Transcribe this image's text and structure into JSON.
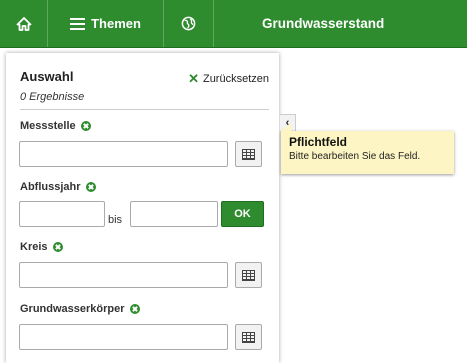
{
  "topbar": {
    "themen_label": "Themen",
    "title": "Grundwasserstand",
    "icons": [
      "home-icon",
      "menu-icon",
      "globe-icon"
    ]
  },
  "panel": {
    "title": "Auswahl",
    "results": "0 Ergebnisse",
    "reset_label": "Zurücksetzen"
  },
  "fields": {
    "messstelle": {
      "label": "Messstelle",
      "value": "",
      "placeholder": ""
    },
    "abflussjahr": {
      "label": "Abflussjahr",
      "from": "",
      "bis": "bis",
      "to": "",
      "ok": "OK"
    },
    "kreis": {
      "label": "Kreis",
      "value": "",
      "placeholder": ""
    },
    "grundwasserkoerper": {
      "label": "Grundwasserkörper",
      "value": "",
      "placeholder": ""
    }
  },
  "tooltip": {
    "title": "Pflichtfeld",
    "text": "Bitte bearbeiten Sie das Feld."
  },
  "colors": {
    "accent": "#2e8b2e",
    "tooltip_bg": "#fdf6c4"
  }
}
